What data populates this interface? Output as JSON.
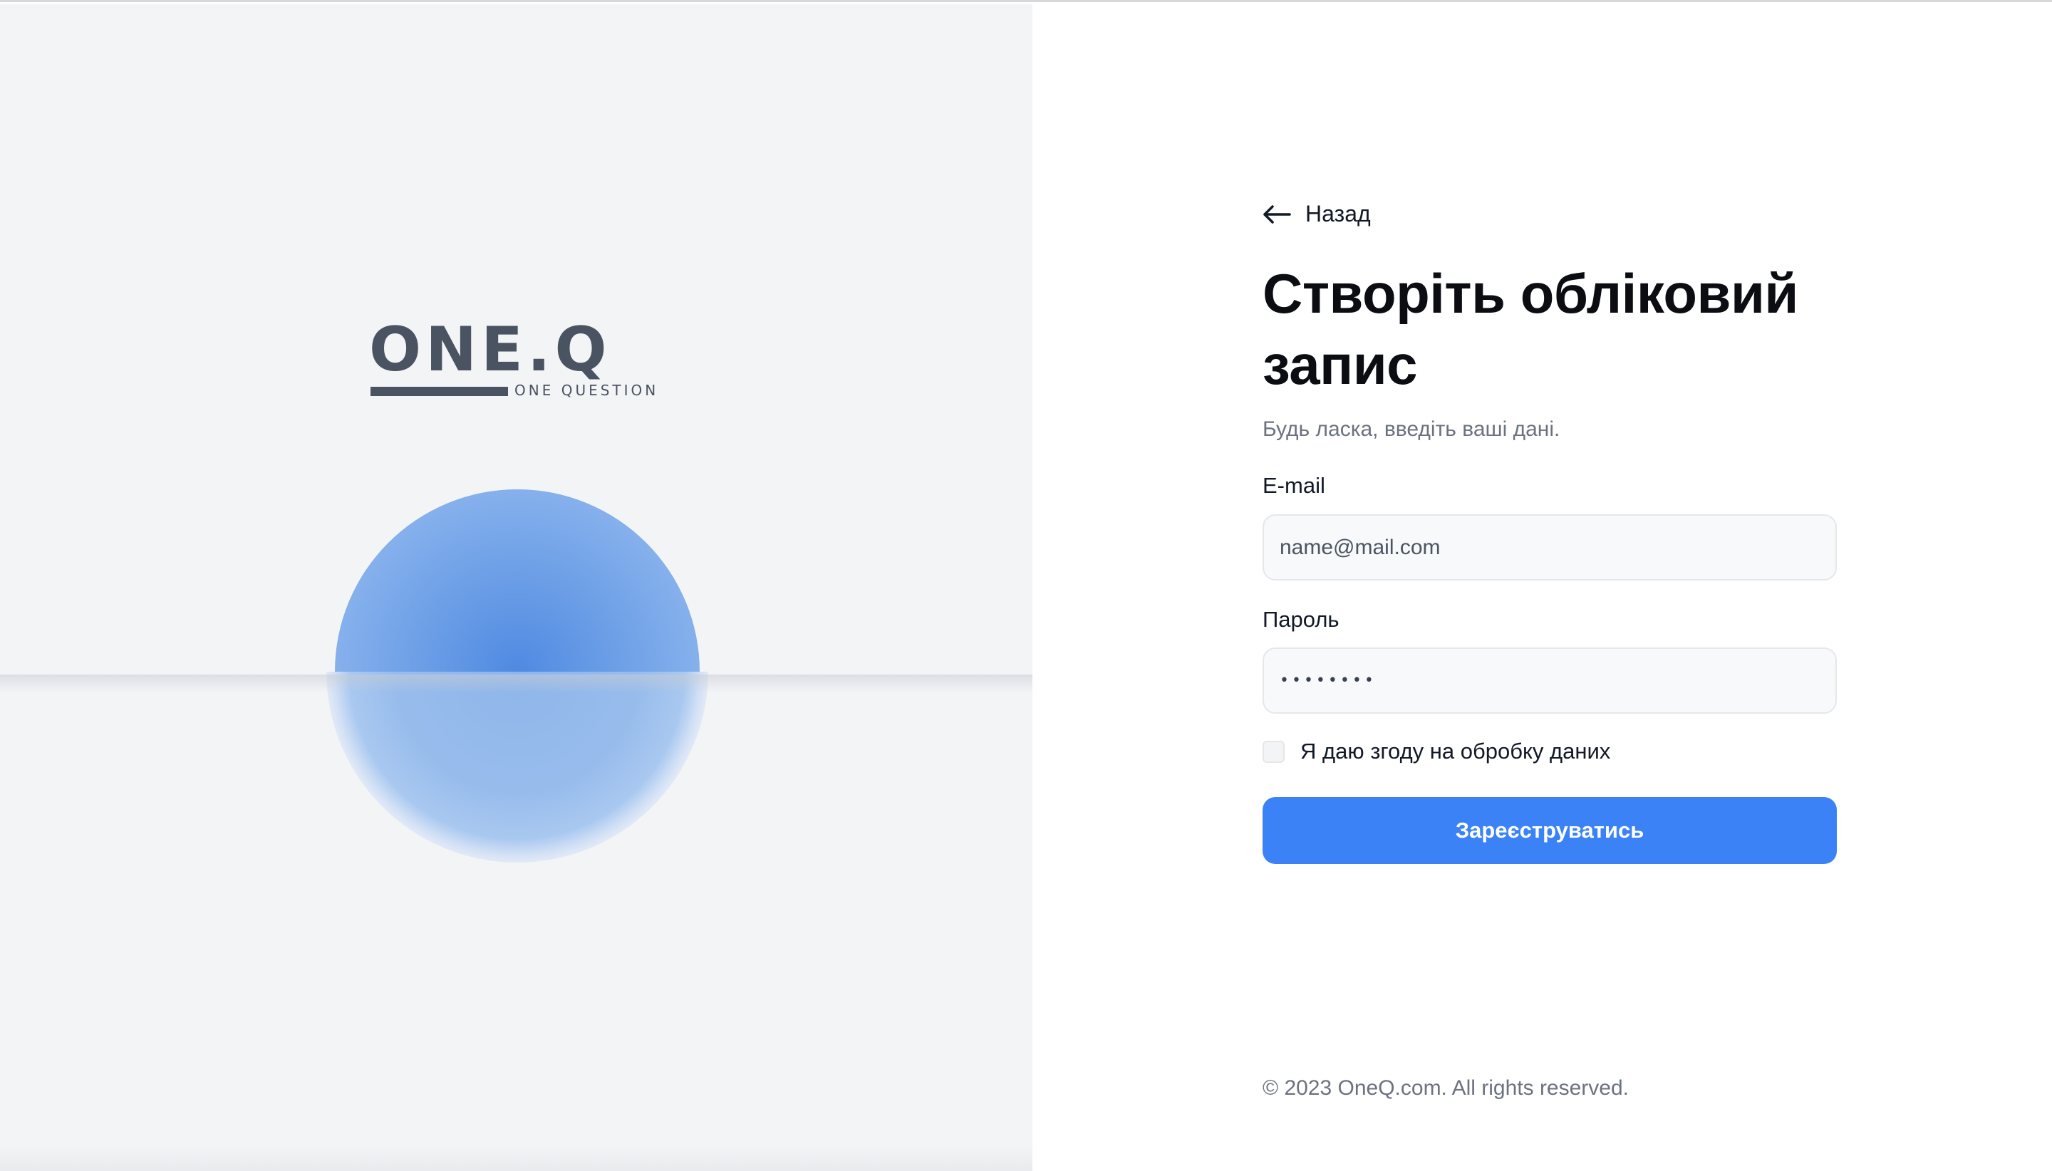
{
  "brand": {
    "logo_word": "ONE.Q",
    "logo_sub": "ONE QUESTION"
  },
  "form": {
    "back_label": "Назад",
    "title": "Створіть обліковий запис",
    "subtitle": "Будь ласка, введіть ваші дані.",
    "email": {
      "label": "E-mail",
      "placeholder": "name@mail.com",
      "value": ""
    },
    "password": {
      "label": "Пароль",
      "value": "••••••••"
    },
    "consent_label": "Я даю згоду на обробку даних",
    "consent_checked": false,
    "submit_label": "Зареєструватись"
  },
  "footer": {
    "copyright": "© 2023 OneQ.com. All rights reserved."
  },
  "colors": {
    "accent": "#3b82f6",
    "hero_bg": "#f3f4f6",
    "logo": "#4a5362",
    "orb": "#4f8ae2"
  },
  "icons": {
    "back": "arrow-left-icon"
  }
}
